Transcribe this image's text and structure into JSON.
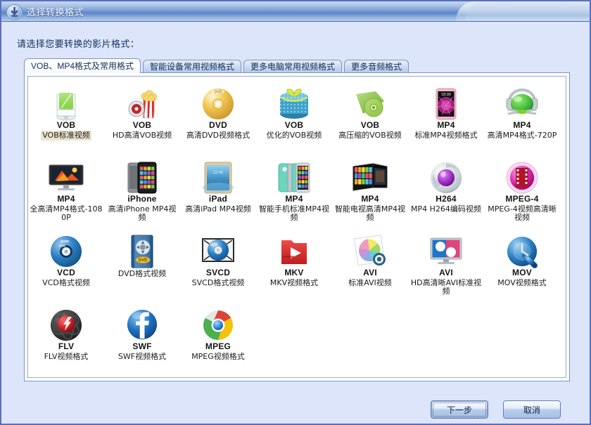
{
  "window": {
    "title": "选择转换格式",
    "app_icon": "download-circle-icon"
  },
  "prompt": "请选择您要转换的影片格式：",
  "tabs": [
    {
      "label": "VOB、MP4格式及常用格式",
      "active": true
    },
    {
      "label": "智能设备常用视频格式",
      "active": false
    },
    {
      "label": "更多电脑常用视频格式",
      "active": false
    },
    {
      "label": "更多音频格式",
      "active": false
    }
  ],
  "formats": [
    {
      "fmt": "VOB",
      "desc": "VOB标准视频",
      "icon": "drive-green-icon",
      "selected": true
    },
    {
      "fmt": "VOB",
      "desc": "HD高清VOB视频",
      "icon": "popcorn-disc-icon",
      "selected": false
    },
    {
      "fmt": "DVD",
      "desc": "高清DVD视频格式",
      "icon": "gold-dvd-disc-icon",
      "selected": false
    },
    {
      "fmt": "VOB",
      "desc": "优化的VOB视频",
      "icon": "blue-gift-box-icon",
      "selected": false
    },
    {
      "fmt": "VOB",
      "desc": "高压缩的VOB视频",
      "icon": "green-folder-disc-icon",
      "selected": false
    },
    {
      "fmt": "MP4",
      "desc": "标准MP4视频格式",
      "icon": "pink-tablet-icon",
      "selected": false
    },
    {
      "fmt": "MP4",
      "desc": "高清MP4格式-720P",
      "icon": "green-headphone-icon",
      "selected": false
    },
    {
      "fmt": "MP4",
      "desc": "全高清MP4格式-1080P",
      "icon": "widescreen-monitor-icon",
      "selected": false
    },
    {
      "fmt": "iPhone",
      "desc": "高清iPhone MP4视频",
      "icon": "iphone-icon",
      "selected": false
    },
    {
      "fmt": "iPad",
      "desc": "高清iPad MP4视频",
      "icon": "ipad-icon",
      "selected": false
    },
    {
      "fmt": "MP4",
      "desc": "智能手机标准MP4视频",
      "icon": "phone-cases-icon",
      "selected": false
    },
    {
      "fmt": "MP4",
      "desc": "智能电视高清MP4视频",
      "icon": "smart-tv-icon",
      "selected": false
    },
    {
      "fmt": "H264",
      "desc": "MP4 H264编码视频",
      "icon": "purple-orb-icon",
      "selected": false
    },
    {
      "fmt": "MPEG-4",
      "desc": "MPEG-4视频高清晰视频",
      "icon": "magenta-filmstrip-icon",
      "selected": false
    },
    {
      "fmt": "VCD",
      "desc": "VCD格式视频",
      "icon": "blue-cd-icon",
      "selected": false
    },
    {
      "fmt": "",
      "desc": "DVD格式视频",
      "icon": "dvd-case-icon",
      "selected": false
    },
    {
      "fmt": "SVCD",
      "desc": "SVCD格式视频",
      "icon": "svcd-disc-case-icon",
      "selected": false
    },
    {
      "fmt": "MKV",
      "desc": "MKV视频格式",
      "icon": "red-play-folder-icon",
      "selected": false
    },
    {
      "fmt": "AVI",
      "desc": "标准AVI视频",
      "icon": "photo-pinwheel-icon",
      "selected": false
    },
    {
      "fmt": "AVI",
      "desc": "HD高清晰AVI标准视频",
      "icon": "monitor-shapes-icon",
      "selected": false
    },
    {
      "fmt": "MOV",
      "desc": "MOV视频格式",
      "icon": "quicktime-q-icon",
      "selected": false
    },
    {
      "fmt": "FLV",
      "desc": "FLV视频格式",
      "icon": "flash-dark-icon",
      "selected": false
    },
    {
      "fmt": "SWF",
      "desc": "SWF视频格式",
      "icon": "blue-f-sphere-icon",
      "selected": false
    },
    {
      "fmt": "MPEG",
      "desc": "MPEG视频格式",
      "icon": "chrome-sphere-icon",
      "selected": false
    }
  ],
  "buttons": {
    "next": "下一步",
    "cancel": "取消"
  },
  "colors": {
    "titlebar_blue": "#5b84c8",
    "window_bg": "#dde5fa",
    "border": "#5a6fc0",
    "selection_highlight": "#ece4cf"
  }
}
